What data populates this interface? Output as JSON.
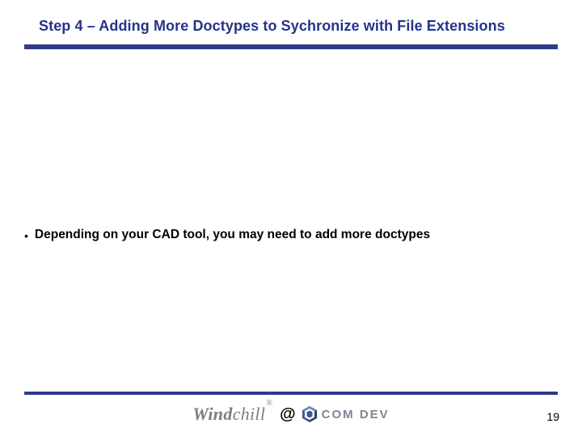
{
  "title": "Step 4 – Adding More Doctypes to Sychronize with File Extensions",
  "bullets": [
    "Depending on your CAD tool, you may need to add more doctypes"
  ],
  "footer": {
    "brand_primary": "Wind",
    "brand_secondary": "chill",
    "registered": "®",
    "at": "@",
    "partner": "COM DEV"
  },
  "page_number": "19",
  "colors": {
    "accent": "#2e3a8c",
    "title": "#24338b",
    "brand_gray": "#7e7e7e",
    "partner_gray": "#7e8693"
  }
}
